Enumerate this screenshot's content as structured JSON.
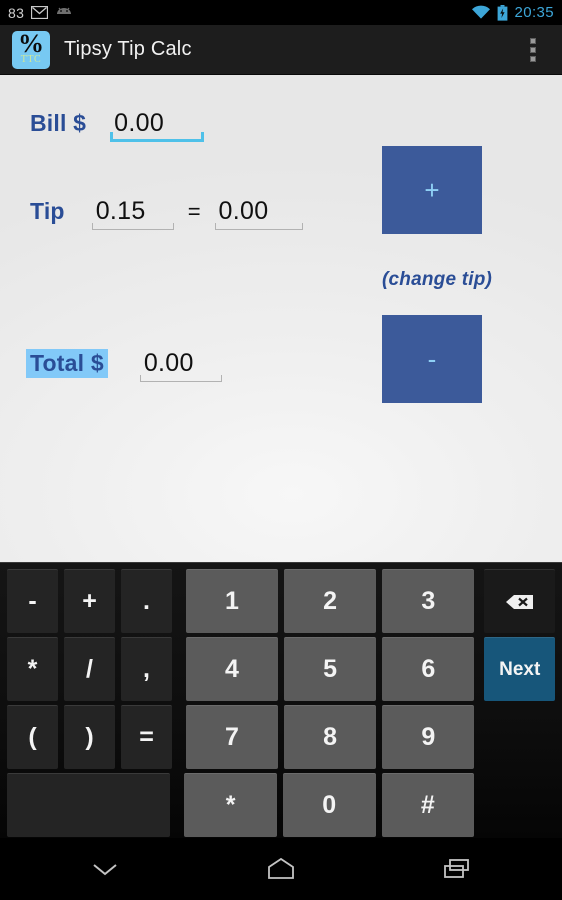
{
  "statusbar": {
    "notification_count": "83",
    "icons": [
      "gmail-icon",
      "android-icon",
      "wifi-icon",
      "battery-charging-icon"
    ],
    "clock": "20:35",
    "accent_color": "#3da6d8"
  },
  "actionbar": {
    "app_icon": {
      "symbol": "%",
      "subtext": "TTC",
      "bg_color": "#77c9f2"
    },
    "title": "Tipsy Tip Calc",
    "overflow_label": "more options"
  },
  "form": {
    "label_color": "#2a4d96",
    "selection_color": "#82c9f8",
    "bill": {
      "label": "Bill $",
      "value": "0.00",
      "focused": true
    },
    "tip": {
      "label": "Tip",
      "rate_value": "0.15",
      "equals": "=",
      "amount_value": "0.00"
    },
    "total": {
      "label": "Total $",
      "value": "0.00",
      "selected": true
    },
    "stepper": {
      "increase_label": "+",
      "decrease_label": "-",
      "caption": "(change tip)",
      "button_color": "#3c5a9a",
      "glyph_color": "#8fd0f5"
    }
  },
  "keyboard": {
    "rows": [
      {
        "fn": [
          "-",
          "+",
          "."
        ],
        "num": [
          "1",
          "2",
          "3"
        ],
        "action": {
          "type": "backspace",
          "label": ""
        }
      },
      {
        "fn": [
          "*",
          "/",
          ","
        ],
        "num": [
          "4",
          "5",
          "6"
        ],
        "action": {
          "type": "next",
          "label": "Next"
        }
      },
      {
        "fn": [
          "(",
          ")",
          "="
        ],
        "num": [
          "7",
          "8",
          "9"
        ],
        "action": {
          "type": "none",
          "label": ""
        }
      },
      {
        "fn": [
          ""
        ],
        "num": [
          "*",
          "0",
          "#"
        ],
        "action": {
          "type": "none",
          "label": ""
        }
      }
    ],
    "next_key_color": "#17567a",
    "num_key_color": "#5b5b5b",
    "fn_key_color": "#242424"
  },
  "navbar": {
    "buttons": [
      "hide-keyboard-icon",
      "home-icon",
      "recents-icon"
    ]
  }
}
